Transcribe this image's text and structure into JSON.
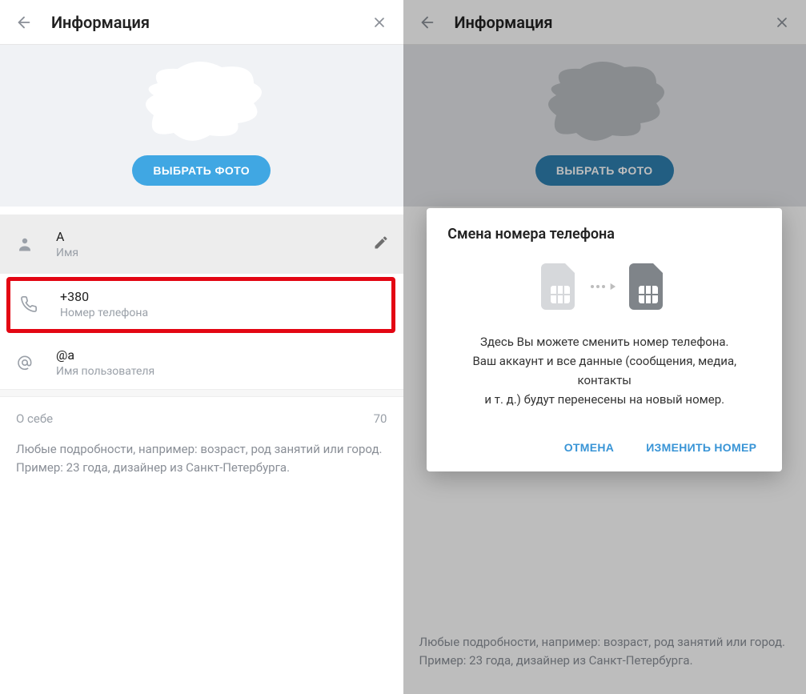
{
  "left": {
    "header": {
      "title": "Информация"
    },
    "choose_photo": "ВЫБРАТЬ ФОТО",
    "name": {
      "value": "А",
      "label": "Имя"
    },
    "phone": {
      "value": "+380",
      "label": "Номер телефона"
    },
    "username": {
      "value": "@a",
      "label": "Имя пользователя"
    },
    "about": {
      "label": "О себе",
      "counter": "70",
      "hint_line1": "Любые подробности, например: возраст, род занятий или город.",
      "hint_line2": "Пример: 23 года, дизайнер из Санкт-Петербурга."
    }
  },
  "right": {
    "header": {
      "title": "Информация"
    },
    "choose_photo": "ВЫБРАТЬ ФОТО",
    "about": {
      "hint_line1": "Любые подробности, например: возраст, род занятий или город.",
      "hint_line2": "Пример: 23 года, дизайнер из Санкт-Петербурга."
    },
    "dialog": {
      "title": "Смена номера телефона",
      "body_line1": "Здесь Вы можете сменить номер телефона.",
      "body_line2": "Ваш аккаунт и все данные (сообщения, медиа, контакты",
      "body_line3": "и т. д.) будут перенесены на новый номер.",
      "cancel": "ОТМЕНА",
      "confirm": "ИЗМЕНИТЬ НОМЕР"
    }
  }
}
